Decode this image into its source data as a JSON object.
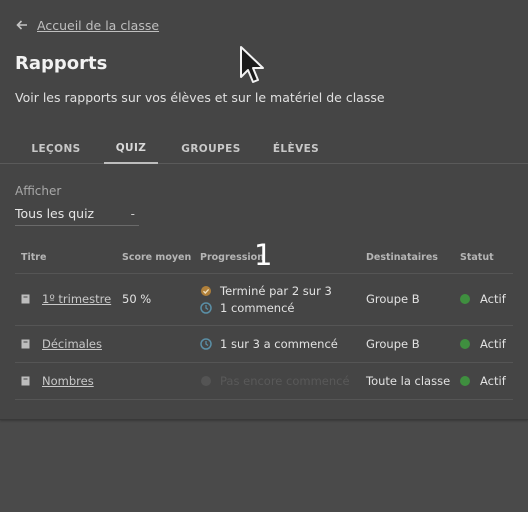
{
  "back_link": {
    "label": "Accueil de la classe",
    "icon": "arrow-left-icon"
  },
  "page": {
    "title": "Rapports",
    "subtitle": "Voir les rapports sur vos élèves et sur le matériel de classe"
  },
  "tabs": [
    {
      "label": "LEÇONS",
      "active": false
    },
    {
      "label": "QUIZ",
      "active": true
    },
    {
      "label": "GROUPES",
      "active": false
    },
    {
      "label": "ÉLÈVES",
      "active": false
    }
  ],
  "filter": {
    "label": "Afficher",
    "value": "Tous les quiz"
  },
  "table": {
    "headers": {
      "title": "Titre",
      "score": "Score moyen",
      "progress": "Progression",
      "recipients": "Destinataires",
      "status": "Statut"
    },
    "rows": [
      {
        "title": "1º trimestre",
        "score": "50 %",
        "progress": [
          "Terminé par 2 sur 3",
          "1 commencé"
        ],
        "recipients": "Groupe B",
        "status": "Actif"
      },
      {
        "title": "Décimales",
        "score": "",
        "progress": [
          "1 sur 3 a commencé"
        ],
        "recipients": "Groupe B",
        "status": "Actif"
      },
      {
        "title": "Nombres",
        "score": "",
        "progress": [
          "Pas encore commencé"
        ],
        "recipients": "Toute la classe",
        "status": "Actif"
      }
    ]
  },
  "overlay_number": "1",
  "colors": {
    "background": "#454545",
    "status_active": "#3f8f3f"
  }
}
